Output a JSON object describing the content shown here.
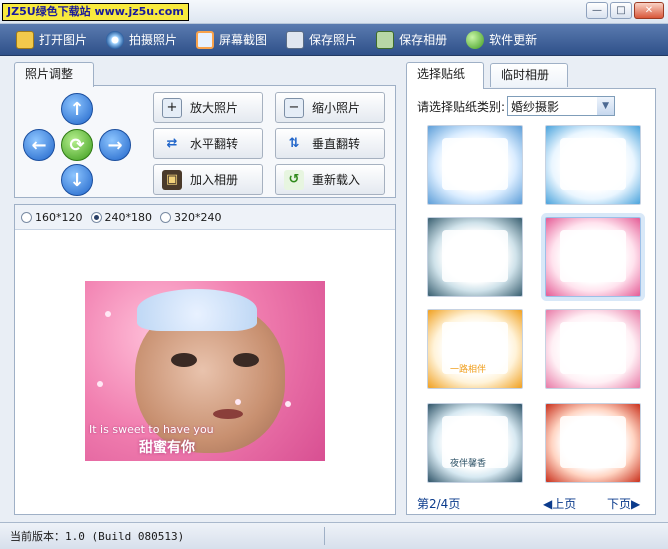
{
  "app": {
    "watermark": "JZ5U绿色下载站 www.jz5u.com"
  },
  "window_buttons": [
    "—",
    "□",
    "✕"
  ],
  "toolbar": {
    "items": [
      {
        "label": "打开图片",
        "icon": "open-folder-icon",
        "color": "#f2c94c"
      },
      {
        "label": "拍摄照片",
        "icon": "webcam-icon",
        "color": "#9fd3ff"
      },
      {
        "label": "屏幕截图",
        "icon": "screenshot-icon",
        "color": "#f8a24c"
      },
      {
        "label": "保存照片",
        "icon": "save-disk-icon",
        "color": "#dfe6f0"
      },
      {
        "label": "保存相册",
        "icon": "album-icon",
        "color": "#b8d7a6"
      },
      {
        "label": "软件更新",
        "icon": "update-globe-icon",
        "color": "#7ecb5a"
      }
    ]
  },
  "left": {
    "tab_label": "照片调整",
    "arrows": {
      "up": "↑",
      "down": "↓",
      "left": "←",
      "right": "→",
      "reset": "⟳"
    },
    "buttons": [
      {
        "label": "放大照片",
        "icon": "zoom-in-icon",
        "glyph": "+"
      },
      {
        "label": "缩小照片",
        "icon": "zoom-out-icon",
        "glyph": "−"
      },
      {
        "label": "水平翻转",
        "icon": "flip-horizontal-icon",
        "glyph": "⇄"
      },
      {
        "label": "垂直翻转",
        "icon": "flip-vertical-icon",
        "glyph": "⇅"
      },
      {
        "label": "加入相册",
        "icon": "add-to-album-icon",
        "glyph": "▣"
      },
      {
        "label": "重新载入",
        "icon": "reload-icon",
        "glyph": "↺"
      }
    ],
    "sizes": [
      {
        "label": "160*120",
        "selected": false
      },
      {
        "label": "240*180",
        "selected": true
      },
      {
        "label": "320*240",
        "selected": false
      }
    ],
    "photo": {
      "caption_en": "It is sweet to have you",
      "caption_cn": "甜蜜有你"
    }
  },
  "right": {
    "tabs": [
      "选择贴纸",
      "临时相册"
    ],
    "category_label": "请选择贴纸类别:",
    "category_value": "婚纱摄影",
    "stickers": [
      {
        "name": "blue-butterfly-frame",
        "text": "",
        "colors": [
          "#d9ecff",
          "#5d9ed8"
        ]
      },
      {
        "name": "blue-flower-frame",
        "text": "",
        "colors": [
          "#eaf6ff",
          "#4aa3dc"
        ]
      },
      {
        "name": "castle-night-frame",
        "text": "",
        "colors": [
          "#cfe2ea",
          "#395f70"
        ]
      },
      {
        "name": "pink-border-frame",
        "text": "",
        "colors": [
          "#ffe3ee",
          "#e45b95"
        ]
      },
      {
        "name": "orange-trees-frame",
        "text": "一路相伴",
        "colors": [
          "#fff3d9",
          "#f0a020"
        ]
      },
      {
        "name": "pink-flowers-frame",
        "text": "",
        "colors": [
          "#fff0f5",
          "#e87aa7"
        ]
      },
      {
        "name": "moon-night-frame",
        "text": "夜伴馨香",
        "colors": [
          "#d7e9f2",
          "#2f5468"
        ]
      },
      {
        "name": "red-dress-lady-frame",
        "text": "",
        "colors": [
          "#ffd4c2",
          "#c9301c"
        ]
      }
    ],
    "pager": {
      "page": "第2/4页",
      "prev": "◀上页",
      "next": "下页▶"
    }
  },
  "status": {
    "text": "当前版本：1.0 (Build 080513)"
  }
}
